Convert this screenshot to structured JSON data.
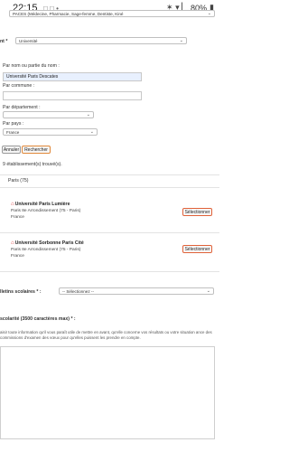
{
  "status_bar": {
    "time": "22:15",
    "battery": "80%",
    "icons_left": "□ □ •",
    "icons_right": "✶ ▾ ▏"
  },
  "top_select": {
    "label": "PACES (Médecine, Pharmacie, Sage-femme, Dentiste, Kiné",
    "arrow": "⌄"
  },
  "etablissement": {
    "label": "nt *",
    "type_value": "Université"
  },
  "search": {
    "by_name_label": "Par nom ou partie du nom :",
    "by_name_value": "Université Paris Descates",
    "by_commune_label": "Par commune :",
    "by_commune_value": "",
    "by_departement_label": "Par département :",
    "by_departement_value": "",
    "by_pays_label": "Par pays :",
    "by_pays_value": "France",
    "cancel_label": "Annuler",
    "search_label": "Rechercher"
  },
  "results": {
    "count_label": "9 établissement(s) trouvé(s).",
    "group_label": "Paris (75)",
    "items": [
      {
        "name": "Université Paris Lumière",
        "address": "Paris 8e Arrondissement (75 - Paris)",
        "country": "France",
        "button": "Sélectionner"
      },
      {
        "name": "Université Sorbonne Paris Cité",
        "address": "Paris 8e Arrondissement (75 - Paris)",
        "country": "France",
        "button": "Sélectionner"
      }
    ]
  },
  "bulletins": {
    "label": "lletins scolaires * :",
    "value": "-- Sélectionnez --"
  },
  "scolarite": {
    "label": "scolarité (3500 caractères max) * :",
    "help": "aisir toute information qu'il vous paraît utile de mettre en avant, qu'elle concerne vos résultats ou votre situation ance des commissions d'examen des vœux pour qu'elles puissent les prendre en compte.",
    "text": ""
  }
}
